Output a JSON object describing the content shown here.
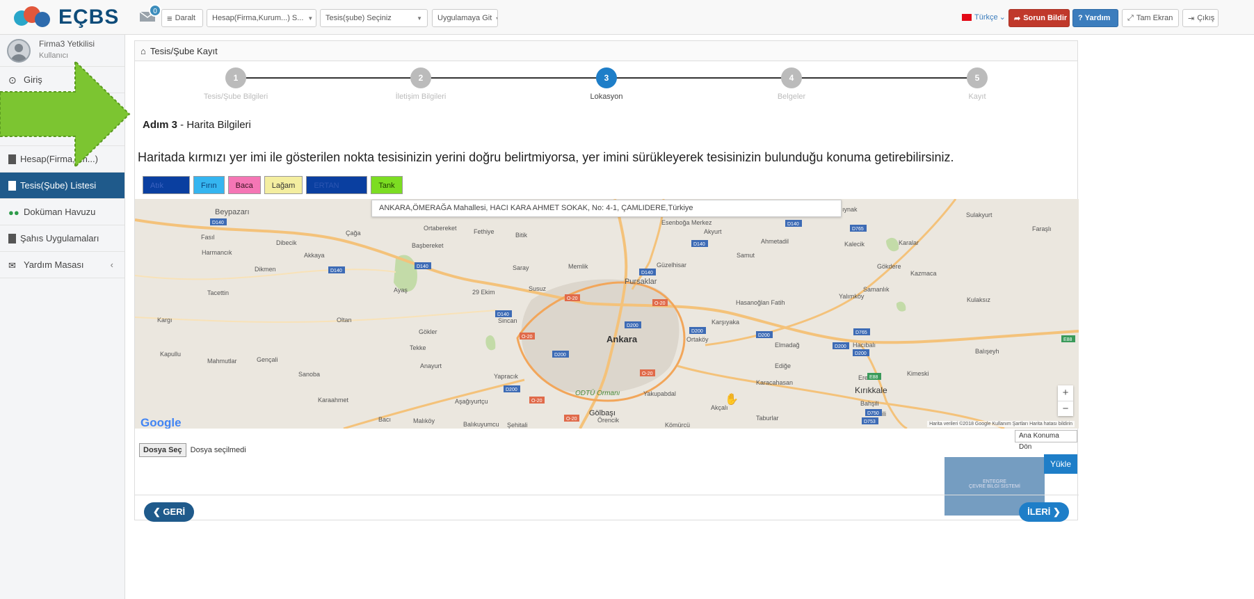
{
  "app": {
    "logo": "EÇBS",
    "mail_badge": "0"
  },
  "topbar": {
    "collapse": "Daralt",
    "account_select": "Hesap(Firma,Kurum...) S...",
    "facility_select": "Tesis(şube) Seçiniz",
    "app_select": "Uygulamaya Git",
    "language": "Türkçe",
    "report_issue": "Sorun Bildir",
    "help": "Yardım",
    "fullscreen": "Tam Ekran",
    "logout": "Çıkış"
  },
  "sidebar": {
    "user_name": "Firma3 Yetkilisi",
    "user_role": "Kullanıcı",
    "items": [
      {
        "label": "Giriş"
      },
      {
        "label": "Hesap(Firma,...n...)"
      },
      {
        "label": "Tesis(Şube) Listesi"
      },
      {
        "label": "Doküman Havuzu"
      },
      {
        "label": "Şahıs Uygulamaları"
      },
      {
        "label": "Yardım Masası"
      }
    ]
  },
  "panel": {
    "title": "Tesis/Şube Kayıt",
    "steps": [
      {
        "num": "1",
        "label": "Tesis/Şube Bilgileri"
      },
      {
        "num": "2",
        "label": "İletişim Bilgileri"
      },
      {
        "num": "3",
        "label": "Lokasyon"
      },
      {
        "num": "4",
        "label": "Belgeler"
      },
      {
        "num": "5",
        "label": "Kayıt"
      }
    ],
    "active_step": 3,
    "step_title_bold": "Adım 3",
    "step_title_rest": " - Harita Bilgileri",
    "instruction": "Haritada kırmızı yer imi ile gösterilen nokta tesisinizin yerini doğru belirtmiyorsa, yer imini sürükleyerek tesisinizin bulunduğu konuma getirebilirsiniz.",
    "layers": [
      {
        "label": "Atık Tesisi",
        "color": "#0a3fa0",
        "text": "#3d63c0"
      },
      {
        "label": "Fırın",
        "color": "#35b5f0",
        "text": "#0b3f78"
      },
      {
        "label": "Baca",
        "color": "#f576b5",
        "text": "#3a1020"
      },
      {
        "label": "Lağam",
        "color": "#f4eea0",
        "text": "#333"
      },
      {
        "label": "ERTAN CİSMİ",
        "color": "#0a3fa0",
        "text": "#2c56b2"
      },
      {
        "label": "Tank",
        "color": "#7cdd22",
        "text": "#1d3d00"
      }
    ],
    "map": {
      "address": "ANKARA,ÖMERAĞA Mahallesi, HACI KARA AHMET SOKAK, No: 4-1, ÇAMLIDERE,Türkiye",
      "attribution": "Harita verileri ©2018 Google   Kullanım Şartları   Harita hatası bildirin",
      "google": "Google",
      "zoom_in": "+",
      "zoom_out": "−",
      "places": [
        "Beypazarı",
        "Ortabereket",
        "Fethiye",
        "Bitik",
        "Esenboğa Merkez",
        "Akyurt",
        "Sulakyurt",
        "Faraşlı",
        "Fasıl",
        "Çağa",
        "Dibecik",
        "Başbereket",
        "Ahmetadil",
        "Kalecik",
        "Karalar",
        "Harmancık",
        "Akkaya",
        "Samut",
        "Dikmen",
        "Saray",
        "Memlik",
        "Güzelhisar",
        "Gökdere",
        "Kazmaca",
        "Pursaklar",
        "Tacettin",
        "Ayaş",
        "29 Ekim",
        "Susuz",
        "Samanlık",
        "Yalımköy",
        "Kulaksız",
        "Hasanoğlan Fatih",
        "Kargı",
        "Oltan",
        "Sincan",
        "Karşıyaka",
        "Gökler",
        "Ankara",
        "Ortaköy",
        "Elmadağ",
        "Hacıbalı",
        "Tekke",
        "Balışeyh",
        "Kapullu",
        "Mahmutlar",
        "Gençali",
        "Anayurt",
        "Ediğe",
        "Sanoba",
        "Yapracık",
        "Erenler",
        "Kimeski",
        "Karacahasan",
        "Kırıkkale",
        "ODTÜ Ormanı",
        "Yakupabdal",
        "Karaahmet",
        "Aşağıyurtçu",
        "Akçalı",
        "Bahşili",
        "Gölbaşı",
        "Örencik",
        "Bacı",
        "Malıköy",
        "Balıkuyumcu",
        "Şehitali",
        "Kömürcü",
        "Taburlar",
        "Ahili",
        "ıynak"
      ],
      "roads": [
        "D140",
        "D140",
        "D140",
        "D140",
        "D140",
        "D140",
        "D140",
        "D765",
        "D200",
        "D200",
        "D200",
        "D200",
        "D200",
        "D765",
        "D200",
        "D200",
        "D750",
        "D753",
        "E88",
        "E88",
        "O-20",
        "O-20",
        "O-20",
        "O-20",
        "O-20",
        "O-20"
      ]
    },
    "home_button": "Ana Konuma Dön",
    "file_button": "Dosya Seç",
    "file_status": "Dosya seçilmedi",
    "upload": "Yükle",
    "watermark_line1": "ENTEGRE",
    "watermark_line2": "ÇEVRE BİLGİ SİSTEMİ",
    "back": "GERİ",
    "next": "İLERİ"
  }
}
